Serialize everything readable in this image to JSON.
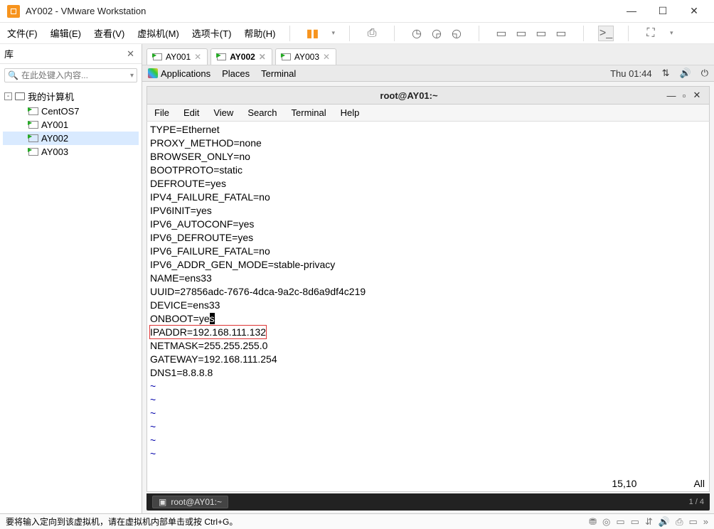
{
  "title": "AY002 - VMware Workstation",
  "menus": {
    "file": "文件(F)",
    "edit": "编辑(E)",
    "view": "查看(V)",
    "vm": "虚拟机(M)",
    "tabs": "选项卡(T)",
    "help": "帮助(H)"
  },
  "sidebar": {
    "header": "库",
    "search_placeholder": "在此处键入内容...",
    "root": "我的计算机",
    "items": [
      "CentOS7",
      "AY001",
      "AY002",
      "AY003"
    ],
    "selected": "AY002"
  },
  "vm_tabs": [
    {
      "label": "AY001",
      "active": false
    },
    {
      "label": "AY002",
      "active": true
    },
    {
      "label": "AY003",
      "active": false
    }
  ],
  "guest_panel": {
    "apps": "Applications",
    "places": "Places",
    "terminal": "Terminal",
    "clock": "Thu 01:44"
  },
  "terminal": {
    "title": "root@AY01:~",
    "menus": [
      "File",
      "Edit",
      "View",
      "Search",
      "Terminal",
      "Help"
    ],
    "lines": [
      "TYPE=Ethernet",
      "PROXY_METHOD=none",
      "BROWSER_ONLY=no",
      "BOOTPROTO=static",
      "DEFROUTE=yes",
      "IPV4_FAILURE_FATAL=no",
      "IPV6INIT=yes",
      "IPV6_AUTOCONF=yes",
      "IPV6_DEFROUTE=yes",
      "IPV6_FAILURE_FATAL=no",
      "IPV6_ADDR_GEN_MODE=stable-privacy",
      "NAME=ens33",
      "UUID=27856adc-7676-4dca-9a2c-8d6a9df4c219",
      "DEVICE=ens33"
    ],
    "onboot_pre": "ONBOOT=ye",
    "onboot_cur": "s",
    "highlighted": "IPADDR=192.168.111.132",
    "lines_after": [
      "NETMASK=255.255.255.0",
      "GATEWAY=192.168.111.254",
      "DNS1=8.8.8.8"
    ],
    "tilde": "~",
    "pos": "15,10",
    "all": "All",
    "task_label": "root@AY01:~",
    "task_right": "1 / 4"
  },
  "status": {
    "text": "要将输入定向到该虚拟机，请在虚拟机内部单击或按 Ctrl+G。"
  }
}
